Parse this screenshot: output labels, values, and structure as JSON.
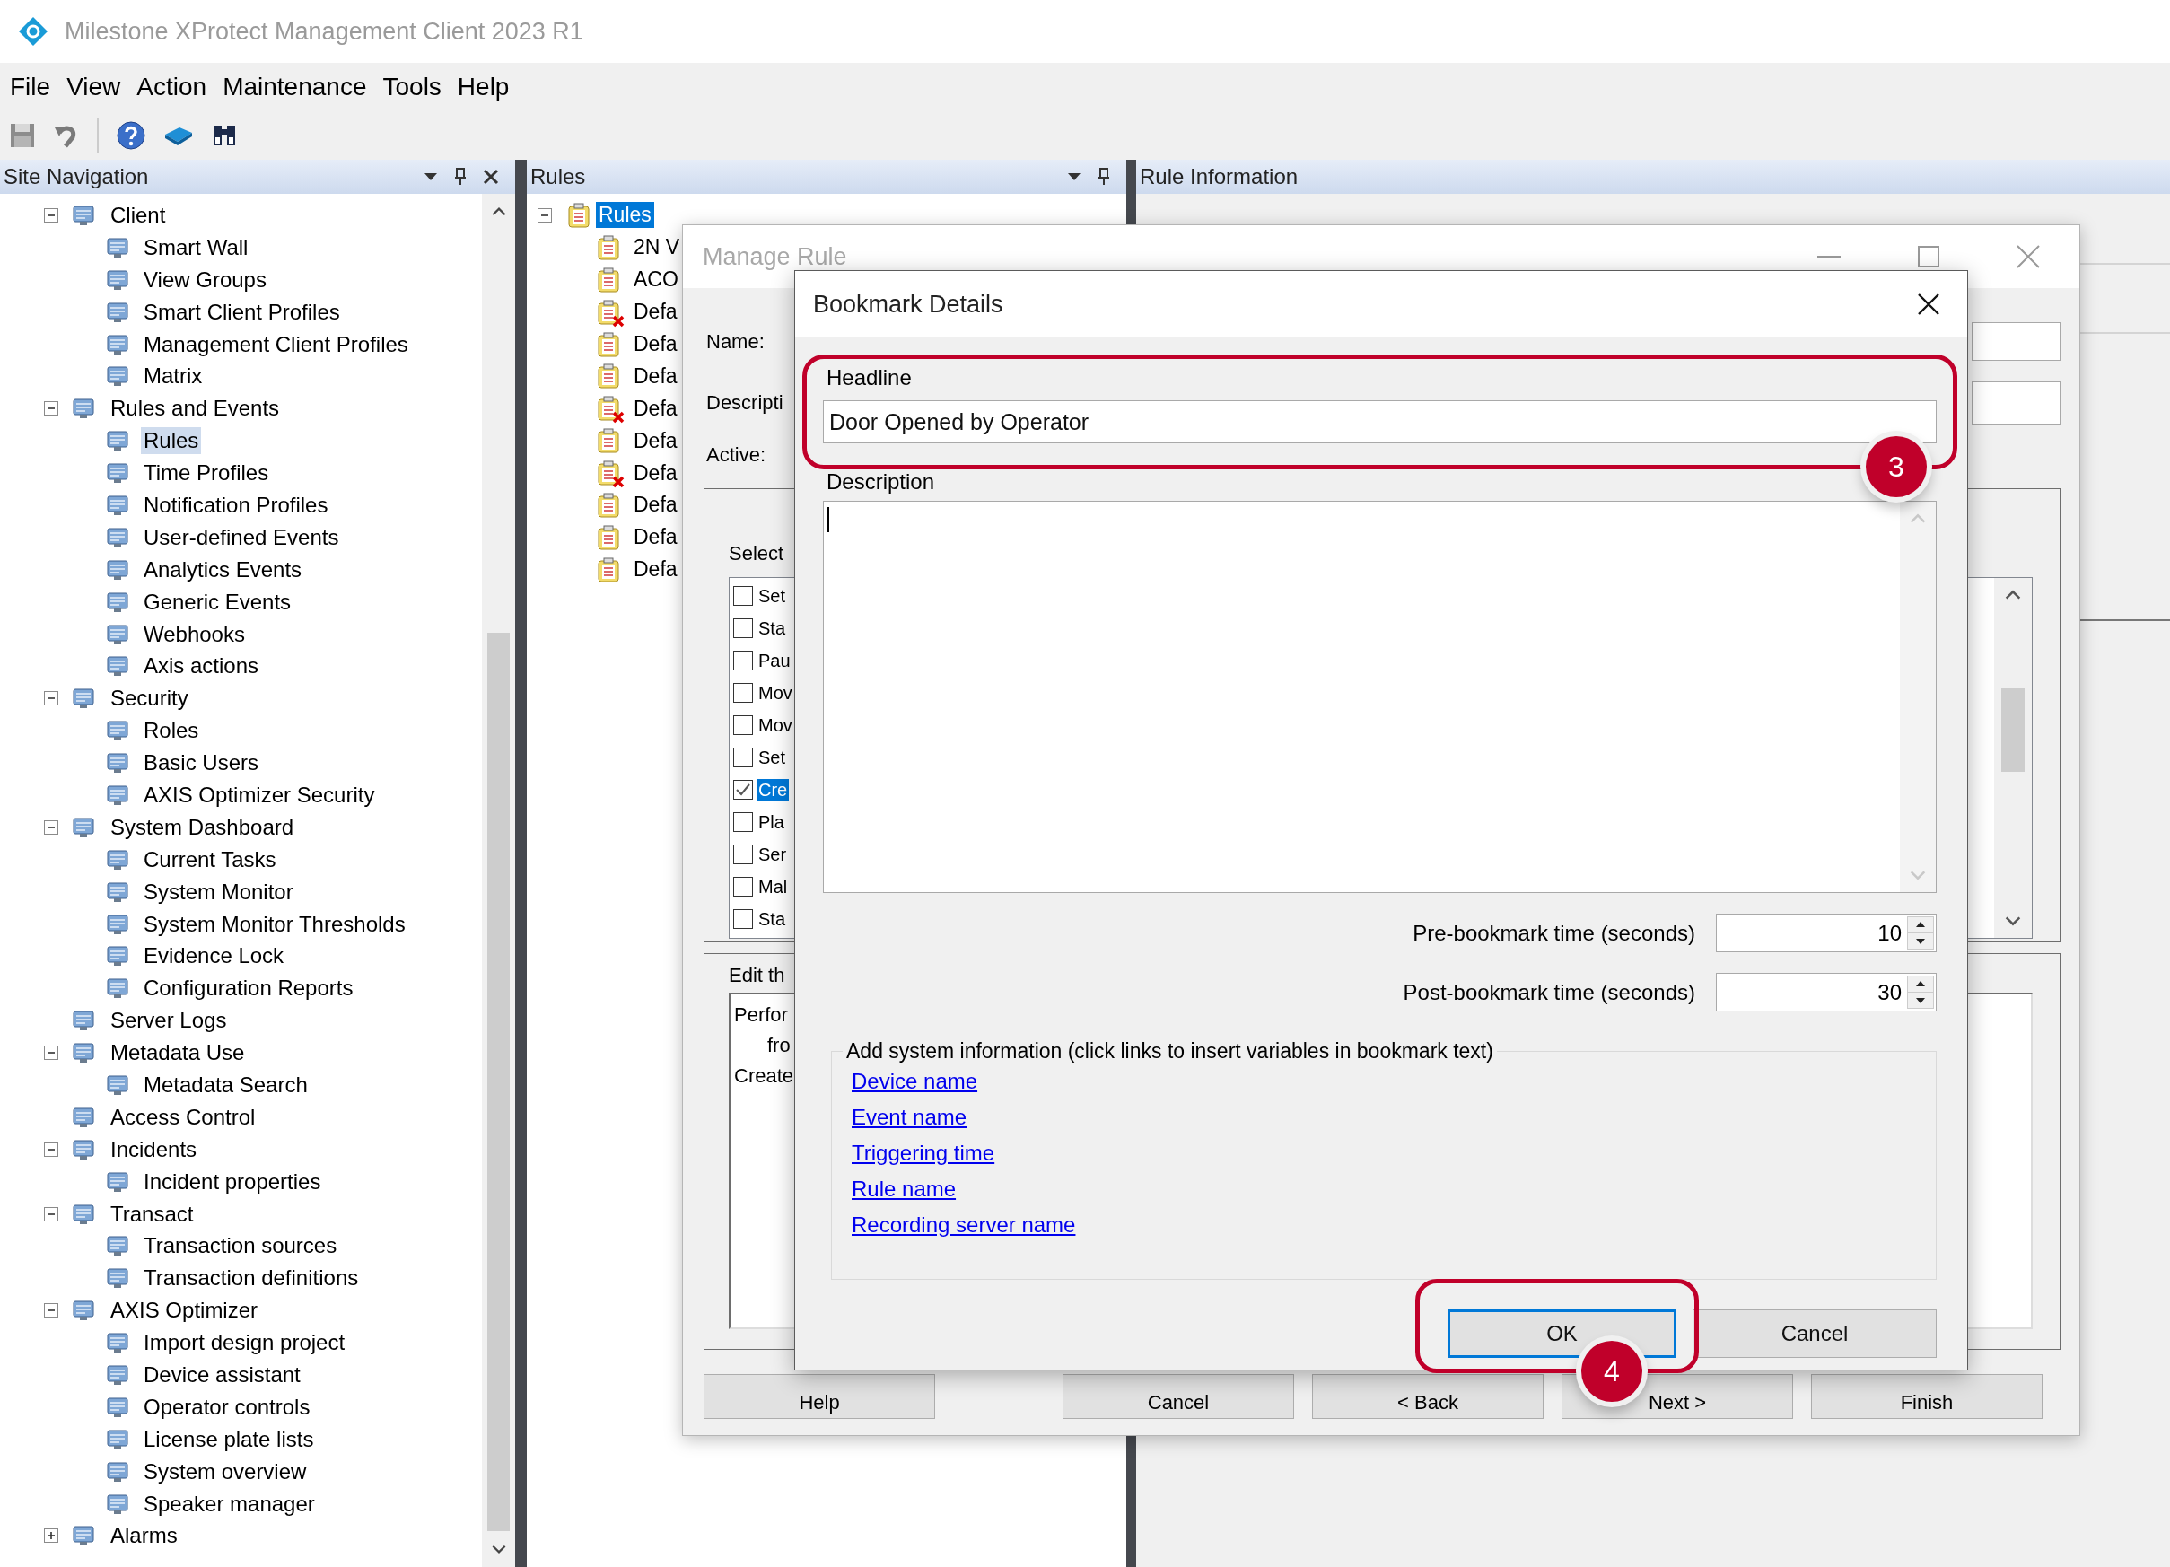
{
  "window": {
    "title": "Milestone XProtect Management Client 2023 R1"
  },
  "menu": [
    "File",
    "View",
    "Action",
    "Maintenance",
    "Tools",
    "Help"
  ],
  "site_navigation": {
    "title": "Site Navigation",
    "tree": [
      {
        "label": "Client",
        "expanded": true,
        "selected": false,
        "children": [
          {
            "label": "Smart Wall",
            "selected": false
          },
          {
            "label": "View Groups",
            "selected": false
          },
          {
            "label": "Smart Client Profiles",
            "selected": false
          },
          {
            "label": "Management Client Profiles",
            "selected": false
          },
          {
            "label": "Matrix",
            "selected": false
          }
        ]
      },
      {
        "label": "Rules and Events",
        "expanded": true,
        "selected": false,
        "children": [
          {
            "label": "Rules",
            "selected": true
          },
          {
            "label": "Time Profiles",
            "selected": false
          },
          {
            "label": "Notification Profiles",
            "selected": false
          },
          {
            "label": "User-defined Events",
            "selected": false
          },
          {
            "label": "Analytics Events",
            "selected": false
          },
          {
            "label": "Generic Events",
            "selected": false
          },
          {
            "label": "Webhooks",
            "selected": false
          },
          {
            "label": "Axis actions",
            "selected": false
          }
        ]
      },
      {
        "label": "Security",
        "expanded": true,
        "selected": false,
        "children": [
          {
            "label": "Roles",
            "selected": false
          },
          {
            "label": "Basic Users",
            "selected": false
          },
          {
            "label": "AXIS Optimizer Security",
            "selected": false
          }
        ]
      },
      {
        "label": "System Dashboard",
        "expanded": true,
        "selected": false,
        "children": [
          {
            "label": "Current Tasks",
            "selected": false
          },
          {
            "label": "System Monitor",
            "selected": false
          },
          {
            "label": "System Monitor Thresholds",
            "selected": false
          },
          {
            "label": "Evidence Lock",
            "selected": false
          },
          {
            "label": "Configuration Reports",
            "selected": false
          }
        ]
      },
      {
        "label": "Server Logs",
        "selected": false
      },
      {
        "label": "Metadata Use",
        "expanded": true,
        "selected": false,
        "children": [
          {
            "label": "Metadata Search",
            "selected": false
          }
        ]
      },
      {
        "label": "Access Control",
        "selected": false
      },
      {
        "label": "Incidents",
        "expanded": true,
        "selected": false,
        "children": [
          {
            "label": "Incident properties",
            "selected": false
          }
        ]
      },
      {
        "label": "Transact",
        "expanded": true,
        "selected": false,
        "children": [
          {
            "label": "Transaction sources",
            "selected": false
          },
          {
            "label": "Transaction definitions",
            "selected": false
          }
        ]
      },
      {
        "label": "AXIS Optimizer",
        "expanded": true,
        "selected": false,
        "children": [
          {
            "label": "Import design project",
            "selected": false
          },
          {
            "label": "Device assistant",
            "selected": false
          },
          {
            "label": "Operator controls",
            "selected": false
          },
          {
            "label": "License plate lists",
            "selected": false
          },
          {
            "label": "System overview",
            "selected": false
          },
          {
            "label": "Speaker manager",
            "selected": false
          }
        ]
      },
      {
        "label": "Alarms",
        "expanded": false,
        "selected": false
      }
    ]
  },
  "rules_panel": {
    "title": "Rules",
    "tree": {
      "label": "Rules",
      "expanded": true,
      "selected": true,
      "children": [
        {
          "label": "2N V",
          "disabled": false,
          "selected": false
        },
        {
          "label": "ACO",
          "disabled": false,
          "selected": false
        },
        {
          "label": "Defa",
          "disabled": true,
          "selected": false
        },
        {
          "label": "Defa",
          "disabled": false,
          "selected": false
        },
        {
          "label": "Defa",
          "disabled": false,
          "selected": false
        },
        {
          "label": "Defa",
          "disabled": true,
          "selected": false
        },
        {
          "label": "Defa",
          "disabled": false,
          "selected": false
        },
        {
          "label": "Defa",
          "disabled": true,
          "selected": false
        },
        {
          "label": "Defa",
          "disabled": false,
          "selected": false
        },
        {
          "label": "Defa",
          "disabled": false,
          "selected": false
        },
        {
          "label": "Defa",
          "disabled": false,
          "selected": false
        }
      ]
    }
  },
  "rule_information": {
    "title": "Rule Information"
  },
  "manage_rule": {
    "title": "Manage Rule",
    "fields": [
      {
        "label": "Name:"
      },
      {
        "label": "Descripti"
      }
    ],
    "active_label": "Active:",
    "select_group": {
      "label": "Select",
      "items": [
        {
          "label": "Set",
          "checked": false,
          "selected": false
        },
        {
          "label": "Sta",
          "checked": false,
          "selected": false
        },
        {
          "label": "Pau",
          "checked": false,
          "selected": false
        },
        {
          "label": "Mov",
          "checked": false,
          "selected": false
        },
        {
          "label": "Mov",
          "checked": false,
          "selected": false
        },
        {
          "label": "Set",
          "checked": false,
          "selected": false
        },
        {
          "label": "Cre",
          "checked": true,
          "selected": true
        },
        {
          "label": "Pla",
          "checked": false,
          "selected": false
        },
        {
          "label": "Ser",
          "checked": false,
          "selected": false
        },
        {
          "label": "Mal",
          "checked": false,
          "selected": false
        },
        {
          "label": "Sta",
          "checked": false,
          "selected": false
        }
      ]
    },
    "edit_group": {
      "label": "Edit th",
      "lines": [
        {
          "kind": "line",
          "text": "Perfor"
        },
        {
          "kind": "continuation",
          "text": "fro"
        },
        {
          "kind": "line",
          "text": "Create"
        }
      ]
    },
    "buttons": [
      "Help",
      "Cancel",
      "< Back",
      "Next >",
      "Finish"
    ]
  },
  "bookmark_details": {
    "title": "Bookmark Details",
    "headline": {
      "label": "Headline",
      "value": "Door Opened by Operator"
    },
    "description": {
      "label": "Description"
    },
    "times": [
      {
        "label": "Pre-bookmark time (seconds)",
        "value": "10"
      },
      {
        "label": "Post-bookmark time (seconds)",
        "value": "30"
      }
    ],
    "system_info": {
      "legend": "Add system information (click links to insert variables in bookmark text)",
      "links": [
        "Device name",
        "Event name",
        "Triggering time",
        "Rule name",
        "Recording server name"
      ]
    },
    "buttons": [
      {
        "label": "OK",
        "focused": true
      },
      {
        "label": "Cancel",
        "focused": false
      }
    ]
  },
  "callouts": [
    {
      "number": "3"
    },
    {
      "number": "4"
    }
  ]
}
